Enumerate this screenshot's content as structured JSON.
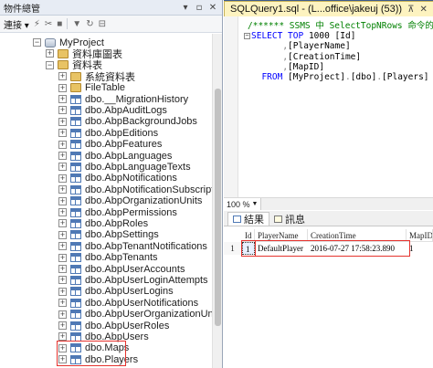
{
  "object_explorer": {
    "title": "物件總管",
    "title_buttons": [
      "▾",
      "▫",
      "✕"
    ],
    "toolbar": {
      "connect_label": "連接 ▾",
      "icons": [
        "connect-icon",
        "disconnect-icon",
        "stop-icon",
        "filter-icon",
        "refresh-icon",
        "collapse-icon"
      ]
    },
    "tree": [
      {
        "id": "db",
        "label": "MyProject",
        "indent": 0,
        "expander": "−",
        "icon": "db"
      },
      {
        "id": "diagrams",
        "label": "資料庫圖表",
        "indent": 1,
        "expander": "+",
        "icon": "folder"
      },
      {
        "id": "tables",
        "label": "資料表",
        "indent": 1,
        "expander": "−",
        "icon": "folder"
      },
      {
        "id": "systables",
        "label": "系統資料表",
        "indent": 2,
        "expander": "+",
        "icon": "folder"
      },
      {
        "id": "filetable",
        "label": "FileTable",
        "indent": 2,
        "expander": "+",
        "icon": "folder"
      },
      {
        "id": "t1",
        "label": "dbo.__MigrationHistory",
        "indent": 2,
        "expander": "+",
        "icon": "table"
      },
      {
        "id": "t2",
        "label": "dbo.AbpAuditLogs",
        "indent": 2,
        "expander": "+",
        "icon": "table"
      },
      {
        "id": "t3",
        "label": "dbo.AbpBackgroundJobs",
        "indent": 2,
        "expander": "+",
        "icon": "table"
      },
      {
        "id": "t4",
        "label": "dbo.AbpEditions",
        "indent": 2,
        "expander": "+",
        "icon": "table"
      },
      {
        "id": "t5",
        "label": "dbo.AbpFeatures",
        "indent": 2,
        "expander": "+",
        "icon": "table"
      },
      {
        "id": "t6",
        "label": "dbo.AbpLanguages",
        "indent": 2,
        "expander": "+",
        "icon": "table"
      },
      {
        "id": "t7",
        "label": "dbo.AbpLanguageTexts",
        "indent": 2,
        "expander": "+",
        "icon": "table"
      },
      {
        "id": "t8",
        "label": "dbo.AbpNotifications",
        "indent": 2,
        "expander": "+",
        "icon": "table"
      },
      {
        "id": "t9",
        "label": "dbo.AbpNotificationSubscriptions",
        "indent": 2,
        "expander": "+",
        "icon": "table"
      },
      {
        "id": "t10",
        "label": "dbo.AbpOrganizationUnits",
        "indent": 2,
        "expander": "+",
        "icon": "table"
      },
      {
        "id": "t11",
        "label": "dbo.AbpPermissions",
        "indent": 2,
        "expander": "+",
        "icon": "table"
      },
      {
        "id": "t12",
        "label": "dbo.AbpRoles",
        "indent": 2,
        "expander": "+",
        "icon": "table"
      },
      {
        "id": "t13",
        "label": "dbo.AbpSettings",
        "indent": 2,
        "expander": "+",
        "icon": "table"
      },
      {
        "id": "t14",
        "label": "dbo.AbpTenantNotifications",
        "indent": 2,
        "expander": "+",
        "icon": "table"
      },
      {
        "id": "t15",
        "label": "dbo.AbpTenants",
        "indent": 2,
        "expander": "+",
        "icon": "table"
      },
      {
        "id": "t16",
        "label": "dbo.AbpUserAccounts",
        "indent": 2,
        "expander": "+",
        "icon": "table"
      },
      {
        "id": "t17",
        "label": "dbo.AbpUserLoginAttempts",
        "indent": 2,
        "expander": "+",
        "icon": "table"
      },
      {
        "id": "t18",
        "label": "dbo.AbpUserLogins",
        "indent": 2,
        "expander": "+",
        "icon": "table"
      },
      {
        "id": "t19",
        "label": "dbo.AbpUserNotifications",
        "indent": 2,
        "expander": "+",
        "icon": "table"
      },
      {
        "id": "t20",
        "label": "dbo.AbpUserOrganizationUnits",
        "indent": 2,
        "expander": "+",
        "icon": "table"
      },
      {
        "id": "t21",
        "label": "dbo.AbpUserRoles",
        "indent": 2,
        "expander": "+",
        "icon": "table"
      },
      {
        "id": "t22",
        "label": "dbo.AbpUsers",
        "indent": 2,
        "expander": "+",
        "icon": "table"
      },
      {
        "id": "t23",
        "label": "dbo.Maps",
        "indent": 2,
        "expander": "+",
        "icon": "table",
        "highlight": true
      },
      {
        "id": "t24",
        "label": "dbo.Players",
        "indent": 2,
        "expander": "+",
        "icon": "table",
        "highlight": true
      }
    ]
  },
  "query_window": {
    "tab_label": "SQLQuery1.sql - (L...office\\jakeuj (53))",
    "tab_close": "✕",
    "pin": "⊼",
    "sql_lines": [
      {
        "parts": [
          {
            "c": "cm",
            "t": "/****** SSMS 中 SelectTopNRows 命令的指令"
          }
        ]
      },
      {
        "parts": [
          {
            "c": "kw",
            "t": "SELECT "
          },
          {
            "c": "kw",
            "t": "TOP "
          },
          {
            "c": "bl",
            "t": "1000 [Id]"
          }
        ]
      },
      {
        "parts": [
          {
            "c": "gr",
            "t": "      ,"
          },
          {
            "c": "bl",
            "t": "[PlayerName]"
          }
        ]
      },
      {
        "parts": [
          {
            "c": "gr",
            "t": "      ,"
          },
          {
            "c": "bl",
            "t": "[CreationTime]"
          }
        ]
      },
      {
        "parts": [
          {
            "c": "gr",
            "t": "      ,"
          },
          {
            "c": "bl",
            "t": "[MapID]"
          }
        ]
      },
      {
        "parts": [
          {
            "c": "kw",
            "t": "  FROM "
          },
          {
            "c": "bl",
            "t": "[MyProject]"
          },
          {
            "c": "gr",
            "t": "."
          },
          {
            "c": "bl",
            "t": "[dbo]"
          },
          {
            "c": "gr",
            "t": "."
          },
          {
            "c": "bl",
            "t": "[Players]"
          }
        ]
      }
    ],
    "zoom": "100 %",
    "results_tabs": [
      {
        "label": "結果",
        "icon": "grid-icon",
        "active": true
      },
      {
        "label": "訊息",
        "icon": "message-icon",
        "active": false
      }
    ],
    "grid": {
      "columns": [
        "Id",
        "PlayerName",
        "CreationTime",
        "MapID"
      ],
      "rows": [
        {
          "num": "1",
          "cells": [
            "1",
            "DefaultPlayer",
            "2016-07-27 17:58:23.890",
            "1"
          ]
        }
      ]
    }
  }
}
